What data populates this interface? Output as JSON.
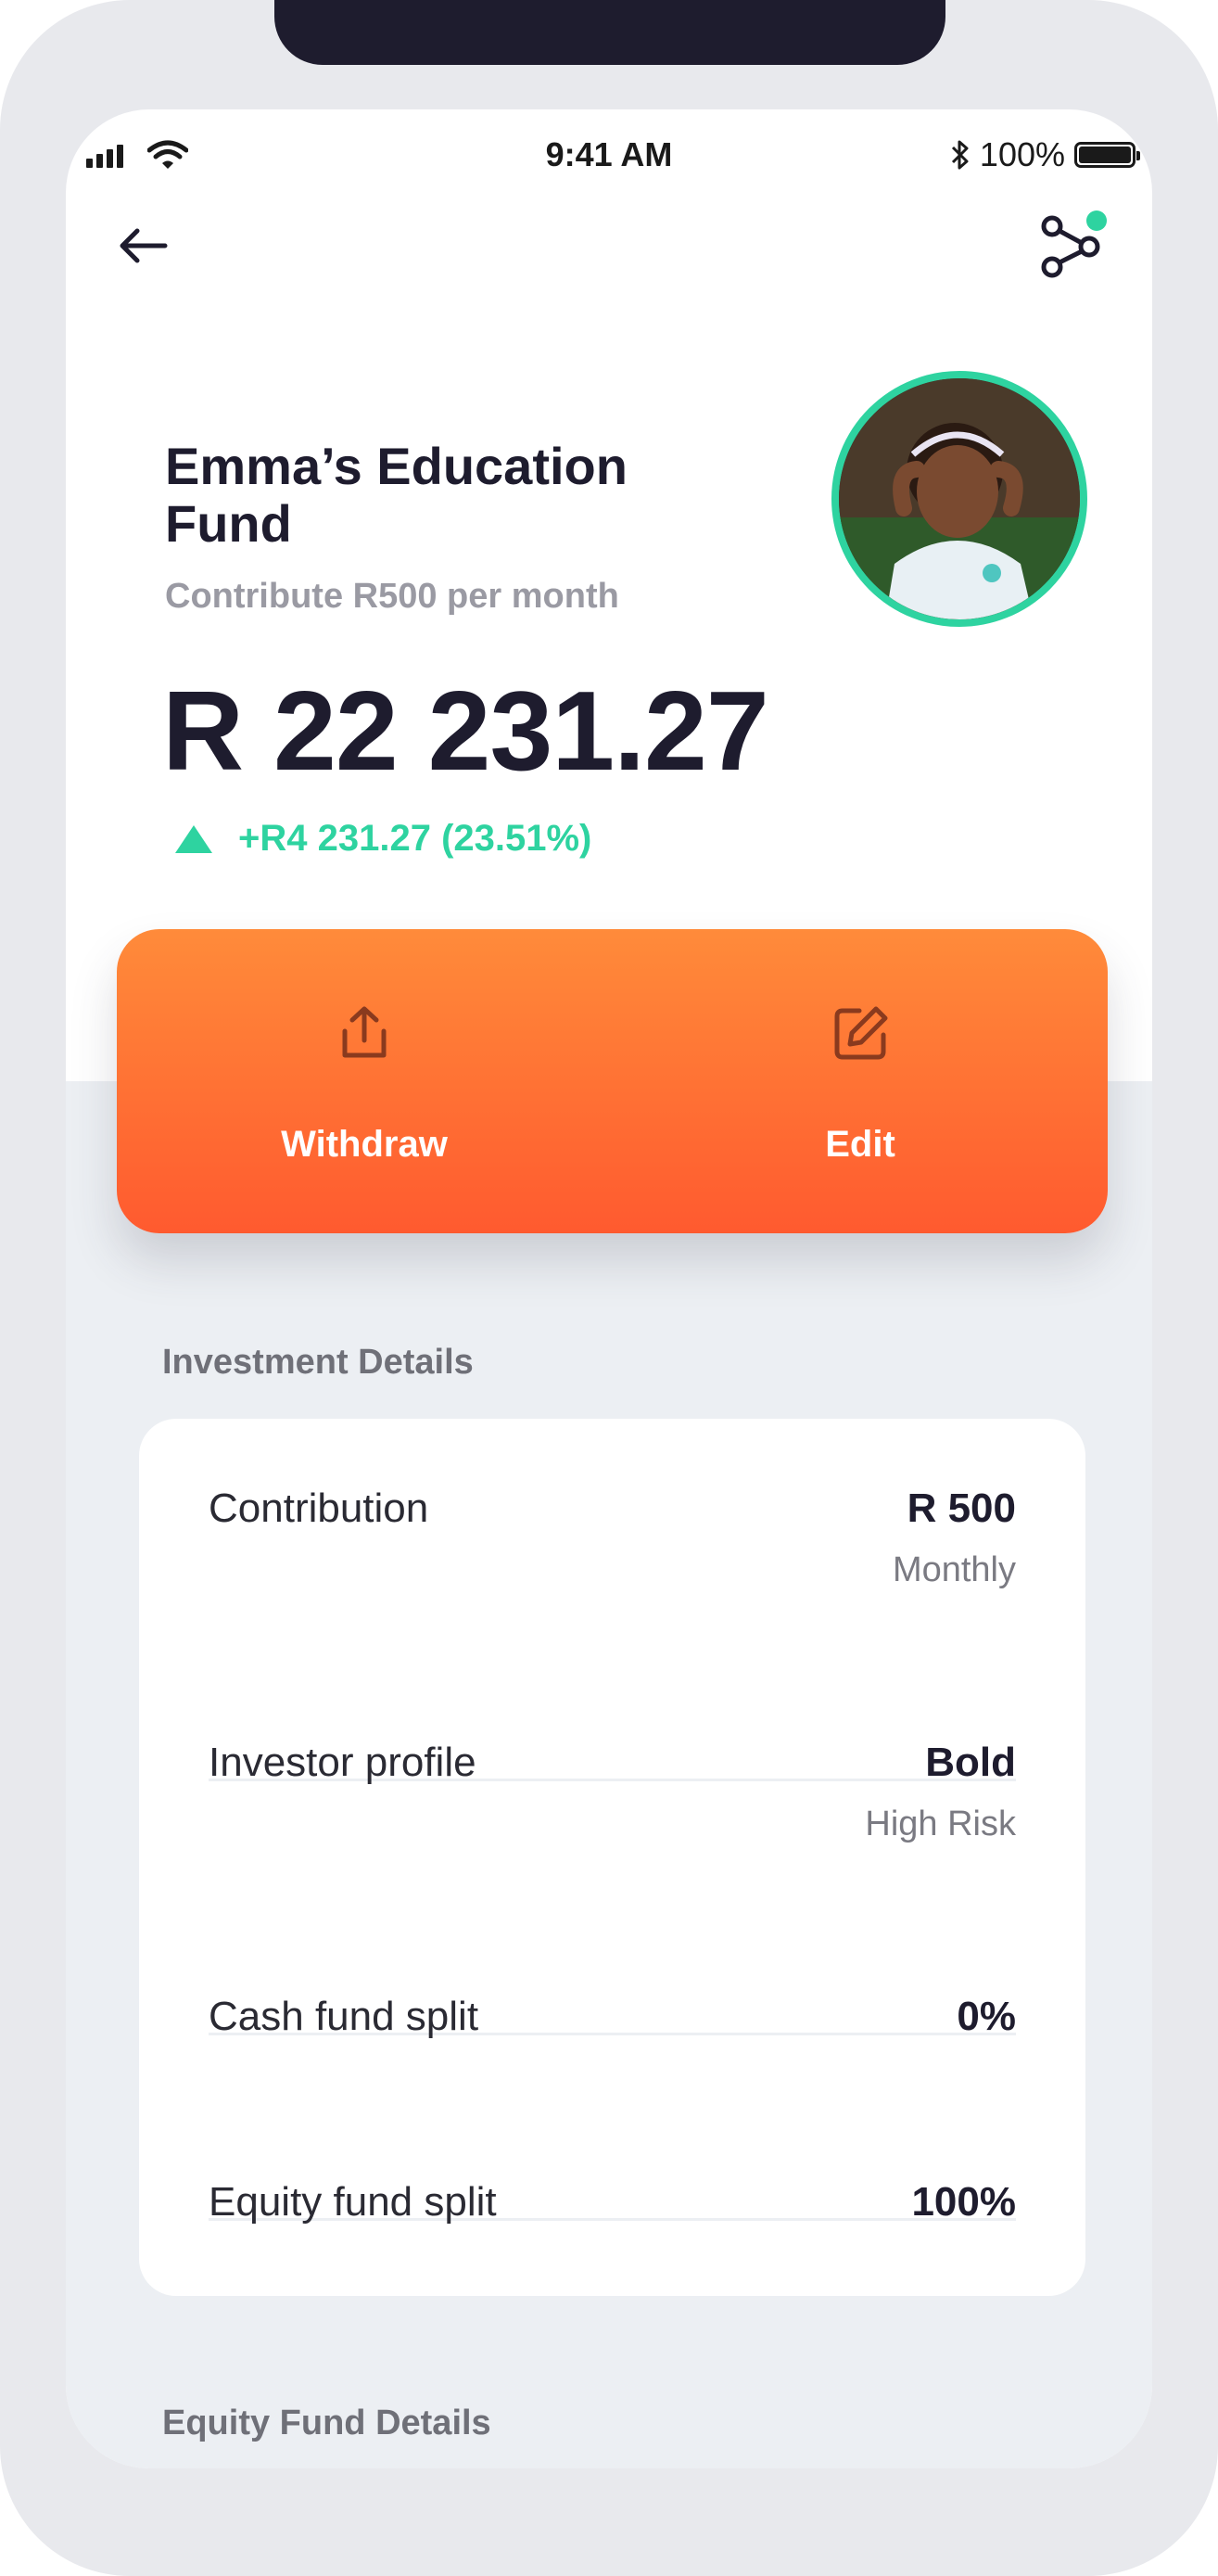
{
  "status_bar": {
    "time": "9:41 AM",
    "battery": "100%"
  },
  "fund": {
    "title": "Emma’s Education Fund",
    "subtitle": "Contribute R500 per month",
    "amount": "R 22 231.27",
    "change": "+R4 231.27 (23.51%)"
  },
  "actions": {
    "withdraw": "Withdraw",
    "edit": "Edit"
  },
  "investment_details": {
    "heading": "Investment Details",
    "rows": [
      {
        "label": "Contribution",
        "value": "R 500",
        "sub": "Monthly"
      },
      {
        "label": "Investor profile",
        "value": "Bold",
        "sub": "High Risk"
      },
      {
        "label": "Cash fund split",
        "value": "0%",
        "sub": ""
      },
      {
        "label": "Equity fund split",
        "value": "100%",
        "sub": ""
      }
    ]
  },
  "equity_fund_details": {
    "heading": "Equity Fund Details"
  },
  "colors": {
    "accent_green": "#2ed3a0",
    "orange_top": "#ff8b3a",
    "orange_bottom": "#ff5a2f",
    "text_dark": "#1e1c2e"
  }
}
